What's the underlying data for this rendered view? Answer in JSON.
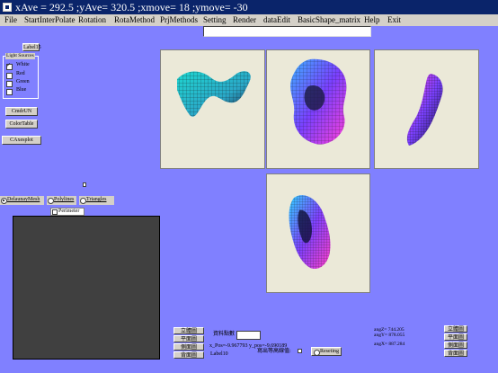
{
  "title": "xAve = 292.5 ;yAve= 320.5 ;xmove= 18 ;ymove= -30",
  "menu": [
    "File",
    "StartInterPolate",
    "Rotation",
    "RotaMethod",
    "PrjMethods",
    "Setting",
    "Render",
    "dataEdit",
    "BasicShape_matrix",
    "Help",
    "Exit"
  ],
  "left": {
    "label15": "Label15",
    "light_legend": "Light Sources",
    "lights": [
      "White",
      "Red",
      "Green",
      "Blue"
    ],
    "buttons": [
      "CmdrUN",
      "ColorTable",
      "CAxesplot"
    ]
  },
  "mode": {
    "options": [
      "DelaunayMesh",
      "Polylines",
      "Triangles"
    ],
    "perimeter": "Perimeter"
  },
  "bottom": {
    "left_buttons": [
      "立體圖",
      "平面圖",
      "側面圖",
      "背面圖"
    ],
    "data_count_label": "資料點數",
    "coord_text": "x_Pos=-9.967793 y_pos=-9.690189",
    "label10": "Label10",
    "write_label": "寫出等高線值:",
    "reset": "Reseting",
    "right_texts": [
      "angZ= 744.205",
      "angY= 878.055",
      "angX= 887.284"
    ],
    "right_buttons": [
      "立體圖",
      "平面圖",
      "側面圖",
      "背面圖"
    ]
  }
}
